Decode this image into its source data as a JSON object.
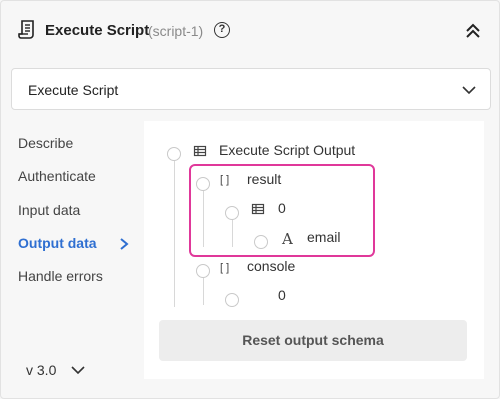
{
  "header": {
    "title": "Execute Script",
    "subtitle": "(script-1)",
    "help_icon": "help-circle-icon",
    "collapse_icon": "double-chevron-up-icon"
  },
  "select": {
    "value": "Execute Script"
  },
  "nav": {
    "items": [
      {
        "label": "Describe"
      },
      {
        "label": "Authenticate"
      },
      {
        "label": "Input data"
      },
      {
        "label": "Output data",
        "active": true
      },
      {
        "label": "Handle errors"
      }
    ]
  },
  "version": {
    "label": "v 3.0"
  },
  "output_tree": {
    "root": {
      "label": "Execute Script Output",
      "type_icon": "⊞"
    },
    "result": {
      "label": "result",
      "type_icon": "[ ]"
    },
    "result_item": {
      "label": "0",
      "type_icon": "⊞"
    },
    "email": {
      "label": "email",
      "type_icon": "A"
    },
    "console": {
      "label": "console",
      "type_icon": "[ ]"
    },
    "console_item": {
      "label": "0"
    }
  },
  "reset_button": {
    "label": "Reset output schema"
  },
  "colors": {
    "accent": "#2f6fd1",
    "highlight": "#e0389a"
  }
}
